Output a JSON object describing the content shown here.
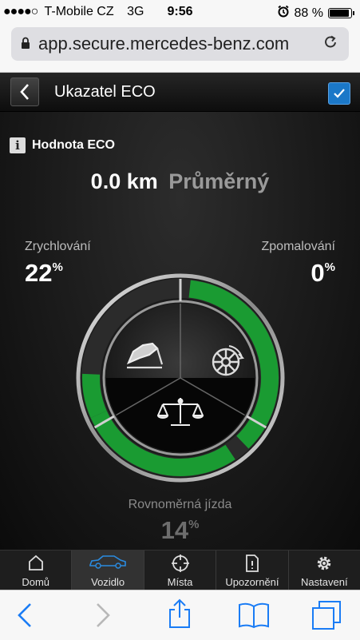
{
  "status_bar": {
    "signal": "●●●●○",
    "carrier": "T-Mobile CZ",
    "network": "3G",
    "time": "9:56",
    "alarm_icon": "alarm-clock-icon",
    "battery": "88 %",
    "battery_level": 0.88
  },
  "browser": {
    "url": "app.secure.mercedes-benz.com"
  },
  "header": {
    "title": "Ukazatel ECO",
    "checkbox_checked": true
  },
  "eco": {
    "label": "Hodnota ECO",
    "distance": "0.0 km",
    "rating": "Průměrný"
  },
  "stats": {
    "acceleration": {
      "label": "Zrychlování",
      "value": "22",
      "unit": "%"
    },
    "deceleration": {
      "label": "Zpomalování",
      "value": "0",
      "unit": "%"
    },
    "steady": {
      "label": "Rovnoměrná jízda",
      "value": "14",
      "unit": "%"
    }
  },
  "gauge": {
    "acceleration_fraction": 0.22,
    "deceleration_fraction": 0.0,
    "steady_fraction": 0.14,
    "colors": {
      "fill": "#1a9b32",
      "track": "#2a2a2a",
      "ring": "#c7c7c7"
    }
  },
  "tabs": [
    {
      "label": "Domů",
      "icon": "home-icon",
      "active": false
    },
    {
      "label": "Vozidlo",
      "icon": "car-icon",
      "active": true
    },
    {
      "label": "Místa",
      "icon": "target-icon",
      "active": false
    },
    {
      "label": "Upozornění",
      "icon": "notification-icon",
      "active": false
    },
    {
      "label": "Nastavení",
      "icon": "gear-icon",
      "active": false
    }
  ],
  "accent_color": "#1b78c8"
}
